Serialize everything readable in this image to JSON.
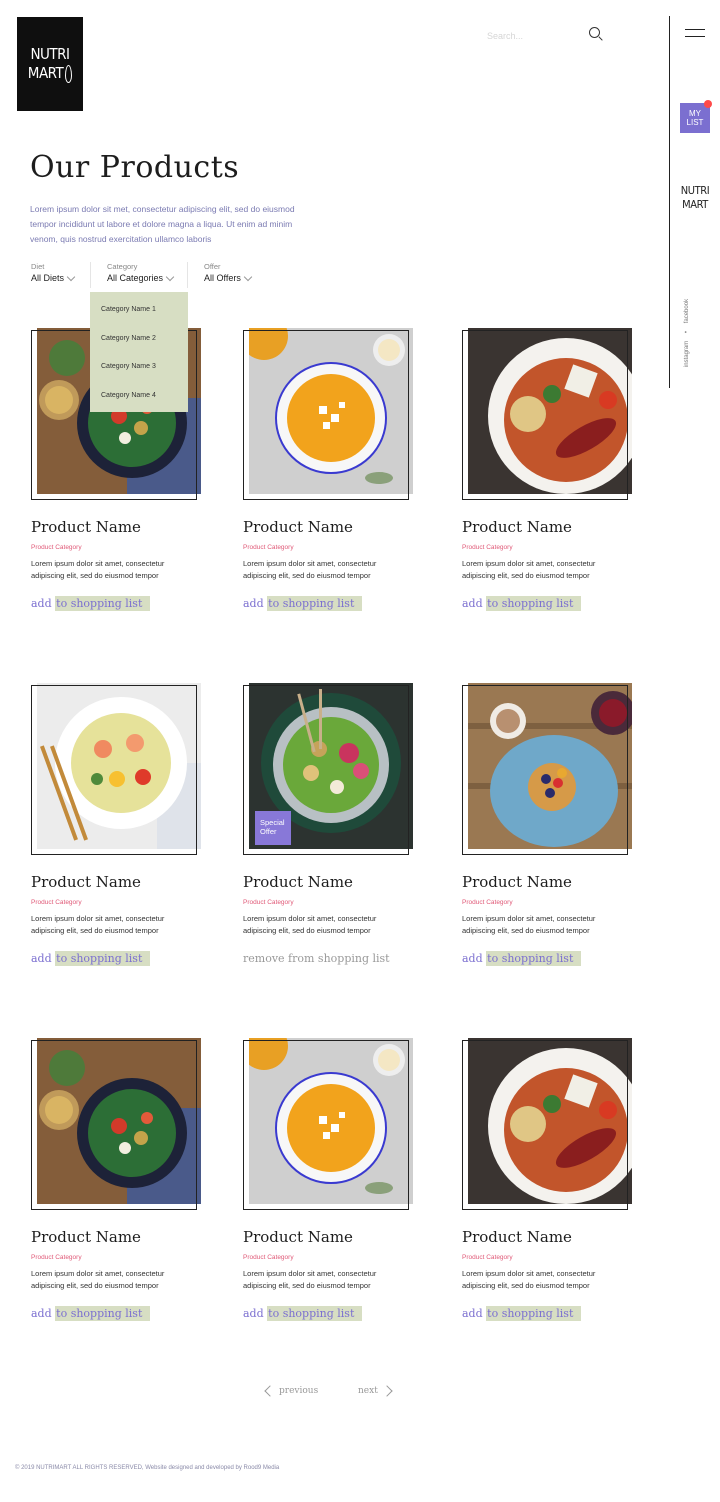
{
  "brand": {
    "line1": "NUTRI",
    "line2": "MART"
  },
  "search": {
    "placeholder": "Search..."
  },
  "rail": {
    "mylist": "MY LIST",
    "logo_line1": "NUTRI",
    "logo_line2": "MART",
    "social": [
      "instagram",
      "facebook"
    ]
  },
  "page": {
    "title": "Our Products",
    "intro": "Lorem ipsum dolor sit met, consectetur adipiscing elit, sed do eiusmod tempor incididunt ut labore et dolore magna a liqua. Ut enim ad minim venom, quis nostrud exercitation ullamco laboris"
  },
  "filters": {
    "diet": {
      "label": "Diet",
      "value": "All Diets"
    },
    "category": {
      "label": "Category",
      "value": "All Categories"
    },
    "offer": {
      "label": "Offer",
      "value": "All Offers"
    },
    "category_options": [
      "Category Name 1",
      "Category Name 2",
      "Category Name 3",
      "Category Name 4"
    ]
  },
  "products": [
    {
      "name": "Product Name",
      "category": "Product Category",
      "desc": "Lorem ipsum dolor sit amet, consectetur adipiscing elit, sed do eiusmod tempor",
      "action_a": "add",
      "action_b": "to shopping list",
      "image": "salad-bowl-image"
    },
    {
      "name": "Product Name",
      "category": "Product Category",
      "desc": "Lorem ipsum dolor sit amet, consectetur adipiscing elit, sed do eiusmod tempor",
      "action_a": "add",
      "action_b": "to shopping list",
      "image": "pumpkin-soup-image"
    },
    {
      "name": "Product Name",
      "category": "Product Category",
      "desc": "Lorem ipsum dolor sit amet, consectetur adipiscing elit, sed do eiusmod tempor",
      "action_a": "add",
      "action_b": "to shopping list",
      "image": "stew-bowl-image"
    },
    {
      "name": "Product Name",
      "category": "Product Category",
      "desc": "Lorem ipsum dolor sit amet, consectetur adipiscing elit, sed do eiusmod tempor",
      "action_a": "add",
      "action_b": "to shopping list",
      "image": "shrimp-salad-image"
    },
    {
      "name": "Product Name",
      "category": "Product Category",
      "desc": "Lorem ipsum dolor sit amet, consectetur adipiscing elit, sed do eiusmod tempor",
      "action_remove": "remove from shopping list",
      "badge": "Special Offer",
      "image": "green-bowl-image"
    },
    {
      "name": "Product Name",
      "category": "Product Category",
      "desc": "Lorem ipsum dolor sit amet, consectetur adipiscing elit, sed do eiusmod tempor",
      "action_a": "add",
      "action_b": "to shopping list",
      "image": "pancakes-image"
    },
    {
      "name": "Product Name",
      "category": "Product Category",
      "desc": "Lorem ipsum dolor sit amet, consectetur adipiscing elit, sed do eiusmod tempor",
      "action_a": "add",
      "action_b": "to shopping list",
      "image": "salad-bowl-image"
    },
    {
      "name": "Product Name",
      "category": "Product Category",
      "desc": "Lorem ipsum dolor sit amet, consectetur adipiscing elit, sed do eiusmod tempor",
      "action_a": "add",
      "action_b": "to shopping list",
      "image": "pumpkin-soup-image"
    },
    {
      "name": "Product Name",
      "category": "Product Category",
      "desc": "Lorem ipsum dolor sit amet, consectetur adipiscing elit, sed do eiusmod tempor",
      "action_a": "add",
      "action_b": "to shopping list",
      "image": "stew-bowl-image"
    }
  ],
  "pagination": {
    "prev": "previous",
    "next": "next"
  },
  "footer": "© 2019 NUTRIMART ALL RIGHTS RESERVED, Website designed and developed by Rood9 Media",
  "colors": {
    "accent": "#7b6fd0",
    "highlight": "#d7dec3",
    "category": "#e05a78",
    "dot": "#ff4a4a"
  }
}
